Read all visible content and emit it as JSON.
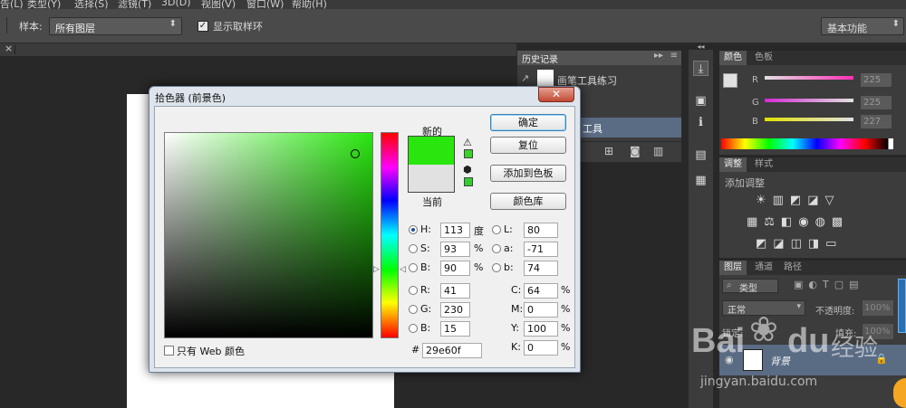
{
  "menubar": {
    "items": [
      "告(L)",
      "类型(Y)",
      "选择(S)",
      "滤镜(T)",
      "3D(D)",
      "视图(V)",
      "窗口(W)",
      "帮助(H)"
    ]
  },
  "options_bar": {
    "sample_label": "样本:",
    "sample_value": "所有图层",
    "show_ring_label": "显示取样环",
    "show_ring_checked": true,
    "workspace": "基本功能"
  },
  "doc_tab": {
    "close": "×"
  },
  "history_panel": {
    "title": "历史记录",
    "snapshot_label": "画笔工具练习",
    "row_label": "工具"
  },
  "color_panel": {
    "tabs": [
      "颜色",
      "色板"
    ],
    "r": "225",
    "g": "225",
    "b": "227",
    "r_label": "R",
    "g_label": "G",
    "b_label": "B"
  },
  "adjust_panel": {
    "tabs": [
      "调整",
      "样式"
    ],
    "add_label": "添加调整"
  },
  "layers_panel": {
    "tabs": [
      "图层",
      "通道",
      "路径"
    ],
    "filter_label": "类型",
    "blend_mode": "正常",
    "opacity_label": "不透明度:",
    "opacity_value": "100%",
    "lock_label": "锁定:",
    "fill_label": "填充:",
    "fill_value": "100%",
    "layer_name": "背景"
  },
  "dialog": {
    "title": "拾色器 (前景色)",
    "new_label": "新的",
    "current_label": "当前",
    "new_color": "#29e60f",
    "current_color": "#e1e1e1",
    "buttons": {
      "ok": "确定",
      "reset": "复位",
      "add_swatch": "添加到色板",
      "color_lib": "颜色库"
    },
    "hsb": {
      "h_label": "H:",
      "h": "113",
      "h_unit": "度",
      "s_label": "S:",
      "s": "93",
      "s_unit": "%",
      "b_label": "B:",
      "b": "90",
      "b_unit": "%"
    },
    "rgb": {
      "r_label": "R:",
      "r": "41",
      "g_label": "G:",
      "g": "230",
      "b_label": "B:",
      "b": "15"
    },
    "lab": {
      "l_label": "L:",
      "l": "80",
      "a_label": "a:",
      "a": "-71",
      "b_label": "b:",
      "b": "74"
    },
    "cmyk": {
      "c_label": "C:",
      "c": "64",
      "m_label": "M:",
      "m": "0",
      "y_label": "Y:",
      "y": "100",
      "k_label": "K:",
      "k": "0",
      "unit": "%"
    },
    "hex_label": "#",
    "hex": "29e60f",
    "web_only_label": "只有 Web 颜色",
    "web_only_checked": false
  },
  "watermark": {
    "brand": "Bai",
    "brand2": "du",
    "cn": "经验",
    "url": "jingyan.baidu.com"
  }
}
